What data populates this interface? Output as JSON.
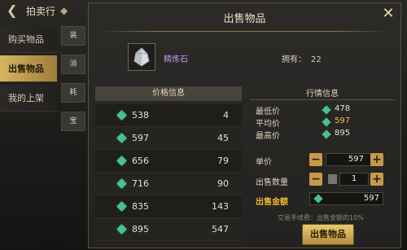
{
  "topbar": {
    "title": "拍卖行"
  },
  "left_tabs": [
    {
      "label": "购买物品",
      "active": false
    },
    {
      "label": "出售物品",
      "active": true
    },
    {
      "label": "我的上架",
      "active": false
    }
  ],
  "mid_tabs": [
    "装",
    "消",
    "耗",
    "宝"
  ],
  "dialog": {
    "title": "出售物品",
    "item_name": "精炼石",
    "owned_label": "拥有：",
    "owned_value": "22"
  },
  "price_list": {
    "header": "价格信息",
    "rows": [
      {
        "price": "538",
        "qty": "4"
      },
      {
        "price": "597",
        "qty": "45"
      },
      {
        "price": "656",
        "qty": "79"
      },
      {
        "price": "716",
        "qty": "90"
      },
      {
        "price": "835",
        "qty": "143"
      },
      {
        "price": "895",
        "qty": "547"
      }
    ]
  },
  "market": {
    "header": "行情信息",
    "min_label": "最低价",
    "min_value": "478",
    "avg_label": "平均价",
    "avg_value": "597",
    "max_label": "最高价",
    "max_value": "895"
  },
  "controls": {
    "unit_price_label": "单价",
    "unit_price": "597",
    "qty_label": "出售数量",
    "qty": "1",
    "total_label": "出售金额",
    "total": "597",
    "minus": "−",
    "plus": "+"
  },
  "fee_text": "交易手续费：出售金额的10%",
  "sell_button": "出售物品",
  "colors": {
    "accent_gold": "#f0b62e",
    "gem_green": "#46c28a",
    "avg_price": "#f0c040",
    "item_purple": "#b59cf0"
  },
  "icons": [
    "back-arrow-icon",
    "diamond-icon",
    "close-icon",
    "crystal-icon",
    "gem-icon",
    "calculator-icon"
  ]
}
